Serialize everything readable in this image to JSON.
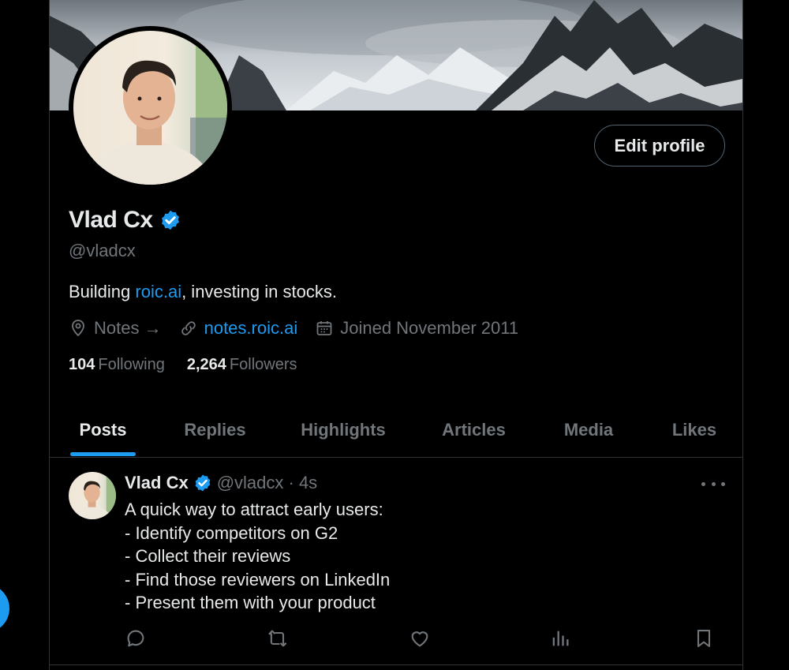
{
  "profile": {
    "name": "Vlad Cx",
    "handle": "@vladcx",
    "bio_prefix": "Building ",
    "bio_link": "roic.ai",
    "bio_suffix": ", investing in stocks.",
    "location": "Notes →",
    "website": "notes.roic.ai",
    "joined": "Joined November 2011",
    "following_count": "104",
    "following_label": "Following",
    "followers_count": "2,264",
    "followers_label": "Followers",
    "edit_label": "Edit profile"
  },
  "tabs": [
    {
      "label": "Posts",
      "active": true
    },
    {
      "label": "Replies",
      "active": false
    },
    {
      "label": "Highlights",
      "active": false
    },
    {
      "label": "Articles",
      "active": false
    },
    {
      "label": "Media",
      "active": false
    },
    {
      "label": "Likes",
      "active": false
    }
  ],
  "post": {
    "author": "Vlad Cx",
    "handle_time": "@vladcx · 4s",
    "lines": [
      "A quick way to attract early users:",
      "- Identify competitors on G2",
      "- Collect their reviews",
      "- Find those reviewers on LinkedIn",
      "- Present them with your product"
    ]
  },
  "icons": {
    "verified": "verified-badge-icon",
    "location": "location-pin-icon",
    "link": "link-icon",
    "calendar": "calendar-icon",
    "reply": "reply-icon",
    "repost": "repost-icon",
    "like": "heart-icon",
    "views": "analytics-icon",
    "bookmark": "bookmark-icon",
    "more": "more-dots-icon"
  },
  "colors": {
    "background": "#000000",
    "accent": "#1d9bf0",
    "text_primary": "#e7e9ea",
    "text_secondary": "#71767b",
    "border": "#2f3336"
  }
}
